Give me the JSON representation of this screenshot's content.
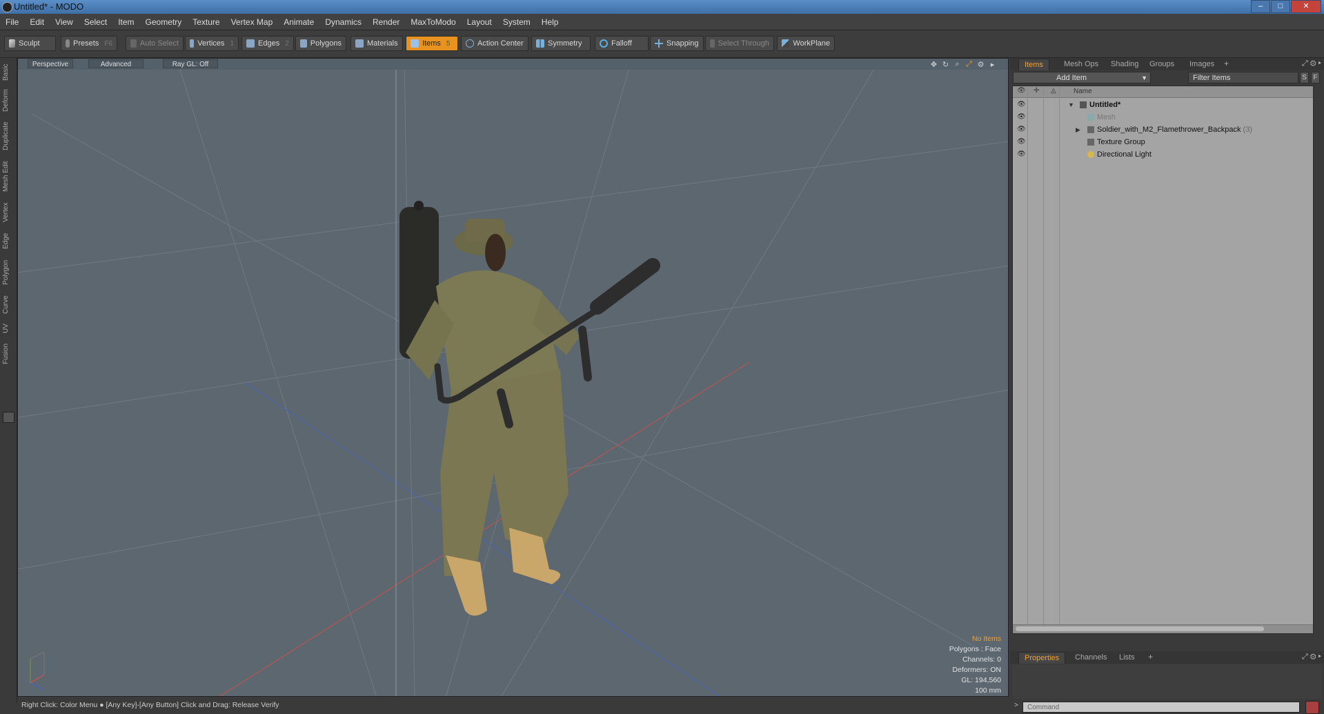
{
  "window": {
    "title": "Untitled* - MODO",
    "buttons": [
      "–",
      "□",
      "✕"
    ]
  },
  "menu": [
    "File",
    "Edit",
    "View",
    "Select",
    "Item",
    "Geometry",
    "Texture",
    "Vertex Map",
    "Animate",
    "Dynamics",
    "Render",
    "MaxToModo",
    "Layout",
    "System",
    "Help"
  ],
  "toolbar": {
    "sculpt": "Sculpt",
    "presets": "Presets",
    "presets_key": "F6",
    "auto_select": "Auto Select",
    "vertices": "Vertices",
    "vertices_key": "1",
    "edges": "Edges",
    "edges_key": "2",
    "polygons": "Polygons",
    "materials": "Materials",
    "items": "Items",
    "items_key": "5",
    "action_center": "Action Center",
    "symmetry": "Symmetry",
    "falloff": "Falloff",
    "snapping": "Snapping",
    "select_through": "Select Through",
    "workplane": "WorkPlane"
  },
  "left_tabs": [
    "Basic",
    "Deform",
    "Duplicate",
    "Mesh Edit",
    "Vertex",
    "Edge",
    "Polygon",
    "Curve",
    "UV",
    "Fusion"
  ],
  "viewport": {
    "view_mode": "Perspective",
    "shading": "Advanced",
    "raygl": "Ray GL: Off",
    "info": {
      "selection": "No Items",
      "polygons": "Polygons : Face",
      "channels": "Channels: 0",
      "deformers": "Deformers: ON",
      "gl": "GL: 194,560",
      "grid": "100 mm"
    }
  },
  "status_bar": "Right Click: Color Menu ● [Any Key]-[Any Button] Click and Drag: Release Verify",
  "right_panel": {
    "tabs": [
      "Items",
      "Mesh Ops",
      "Shading",
      "Groups",
      "Images"
    ],
    "add_item": "Add Item",
    "filter_placeholder": "Filter Items",
    "filter_s": "S",
    "filter_f": "F",
    "column_name": "Name",
    "tree": [
      {
        "label": "Untitled*",
        "count": ""
      },
      {
        "label": "Mesh",
        "count": ""
      },
      {
        "label": "Soldier_with_M2_Flamethrower_Backpack",
        "count": "(3)"
      },
      {
        "label": "Texture Group",
        "count": ""
      },
      {
        "label": "Directional Light",
        "count": ""
      }
    ],
    "bottom_tabs": [
      "Properties",
      "Channels",
      "Lists"
    ],
    "command_placeholder": "Command"
  },
  "colors": {
    "accent": "#e8921f",
    "viewport_bg": "#5d6770",
    "panel_bg": "#3a3a3a",
    "tree_bg": "#a4a4a4"
  }
}
